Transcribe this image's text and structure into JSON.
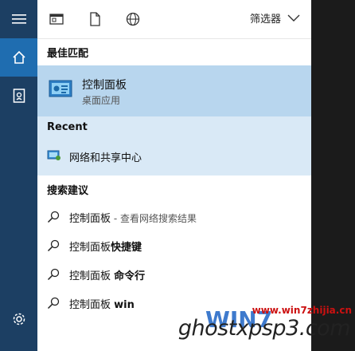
{
  "filter": {
    "label": "筛选器"
  },
  "best_match": {
    "header": "最佳匹配",
    "title": "控制面板",
    "subtitle": "桌面应用"
  },
  "recent": {
    "header": "Recent",
    "items": [
      {
        "label": "网络和共享中心"
      }
    ]
  },
  "suggestions": {
    "header": "搜索建议",
    "items": [
      {
        "query": "控制面板",
        "bold": "",
        "note": " - 查看网络搜索结果"
      },
      {
        "query": "控制面板",
        "bold": "快捷键",
        "note": ""
      },
      {
        "query": "控制面板 ",
        "bold": "命令行",
        "note": ""
      },
      {
        "query": "控制面板 ",
        "bold": "win",
        "note": ""
      }
    ]
  },
  "watermark": {
    "url": "www.win7zhijia.cn",
    "brand": "ghostxpsp3.com",
    "logo": "WIN7"
  },
  "colors": {
    "rail": "#1c3f63",
    "rail_active": "#1f6db0",
    "best_match_bg": "#b8d6ee",
    "recent_bg": "#d9e9f6"
  }
}
